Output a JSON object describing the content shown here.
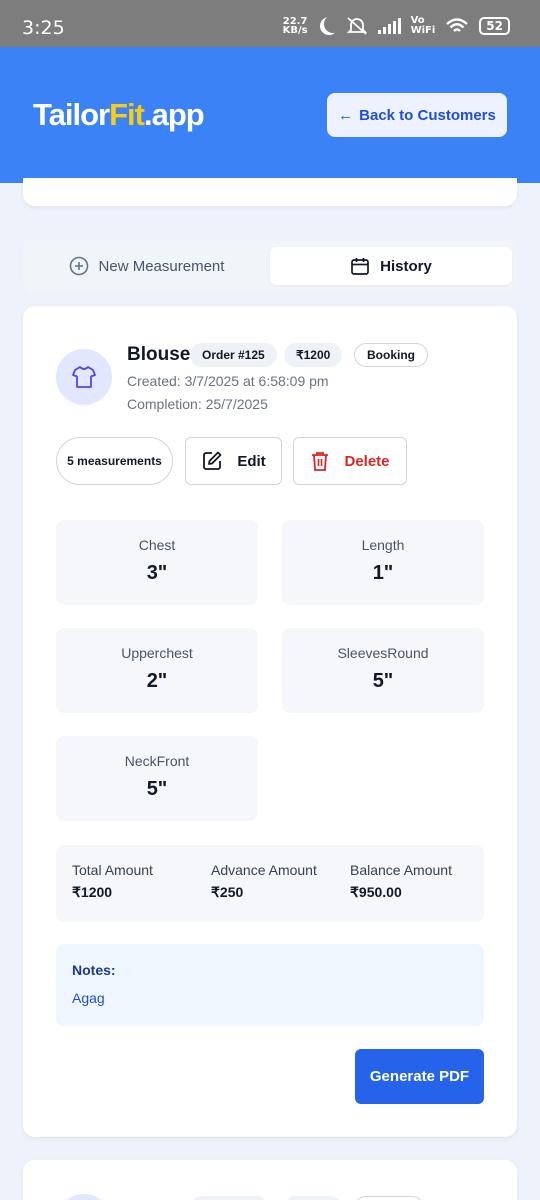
{
  "status_bar": {
    "time": "3:25",
    "net_speed": "22.7",
    "net_unit": "KB/s",
    "vowifi_top": "Vo",
    "vowifi_bottom": "WiFi",
    "battery": "52"
  },
  "header": {
    "logo_primary": "Tailor",
    "logo_accent": "Fit",
    "logo_suffix": ".app",
    "back_label": "Back to Customers",
    "back_arrow": "←",
    "bg_color": "#3b82f6",
    "accent_color": "#facc15"
  },
  "tabs": {
    "new_label": "New Measurement",
    "history_label": "History",
    "active": "History"
  },
  "record": {
    "garment": "Blouse",
    "order_badge": "Order #125",
    "amount_badge": "₹1200",
    "status_badge": "Booking",
    "created": "Created: 3/7/2025 at 6:58:09 pm",
    "completion": "Completion: 25/7/2025",
    "measurement_count": "5 measurements",
    "edit_label": "Edit",
    "delete_label": "Delete",
    "measurements": [
      {
        "label": "Chest",
        "value": "3\""
      },
      {
        "label": "Length",
        "value": "1\""
      },
      {
        "label": "Upperchest",
        "value": "2\""
      },
      {
        "label": "SleevesRound",
        "value": "5\""
      },
      {
        "label": "NeckFront",
        "value": "5\""
      }
    ],
    "amounts": {
      "total_label": "Total Amount",
      "total_value": "₹1200",
      "advance_label": "Advance Amount",
      "advance_value": "₹250",
      "balance_label": "Balance Amount",
      "balance_value": "₹950.00"
    },
    "notes_label": "Notes:",
    "notes_value": "Agag",
    "pdf_label": "Generate PDF"
  },
  "icons": {
    "avatar": "shirt-icon",
    "new_tab": "plus-circle-icon",
    "history_tab": "calendar-icon",
    "edit": "pencil-square-icon",
    "delete": "trash-icon",
    "back": "arrow-left-icon"
  },
  "colors": {
    "primary": "#2563eb",
    "danger": "#dc2626",
    "page_bg": "#eef2fb"
  }
}
